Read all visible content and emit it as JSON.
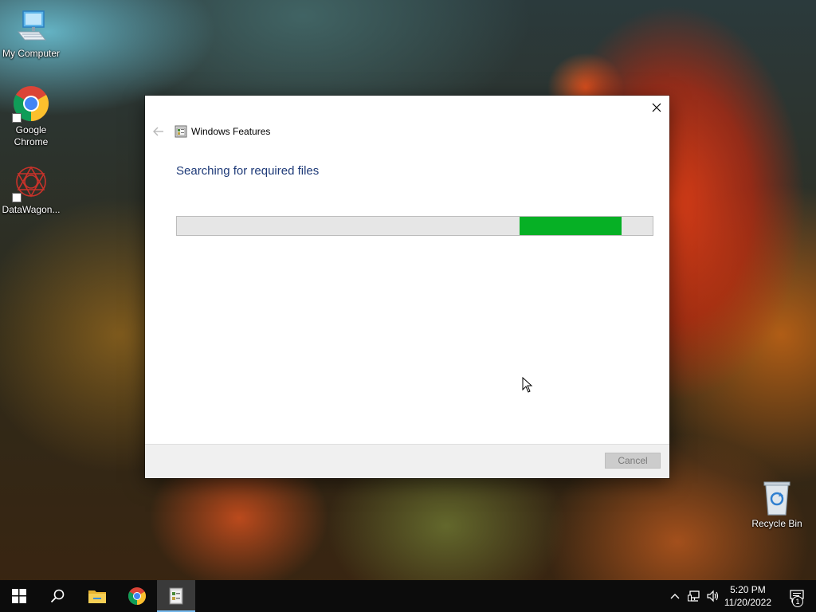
{
  "desktop": {
    "icons": [
      {
        "label": "My Computer"
      },
      {
        "label": "Google Chrome"
      },
      {
        "label": "DataWagon..."
      },
      {
        "label": "Recycle Bin"
      }
    ]
  },
  "dialog": {
    "title": "Windows Features",
    "heading": "Searching for required files",
    "progress": {
      "fill_start": 0.72,
      "fill_end": 0.935,
      "color": "#06b025"
    },
    "cancel_label": "Cancel"
  },
  "taskbar": {
    "apps": [
      "start-icon",
      "search-icon",
      "file-explorer-icon",
      "chrome-icon",
      "windows-features-icon"
    ],
    "clock_time": "5:20 PM",
    "clock_date": "11/20/2022",
    "notification_count": "1"
  }
}
